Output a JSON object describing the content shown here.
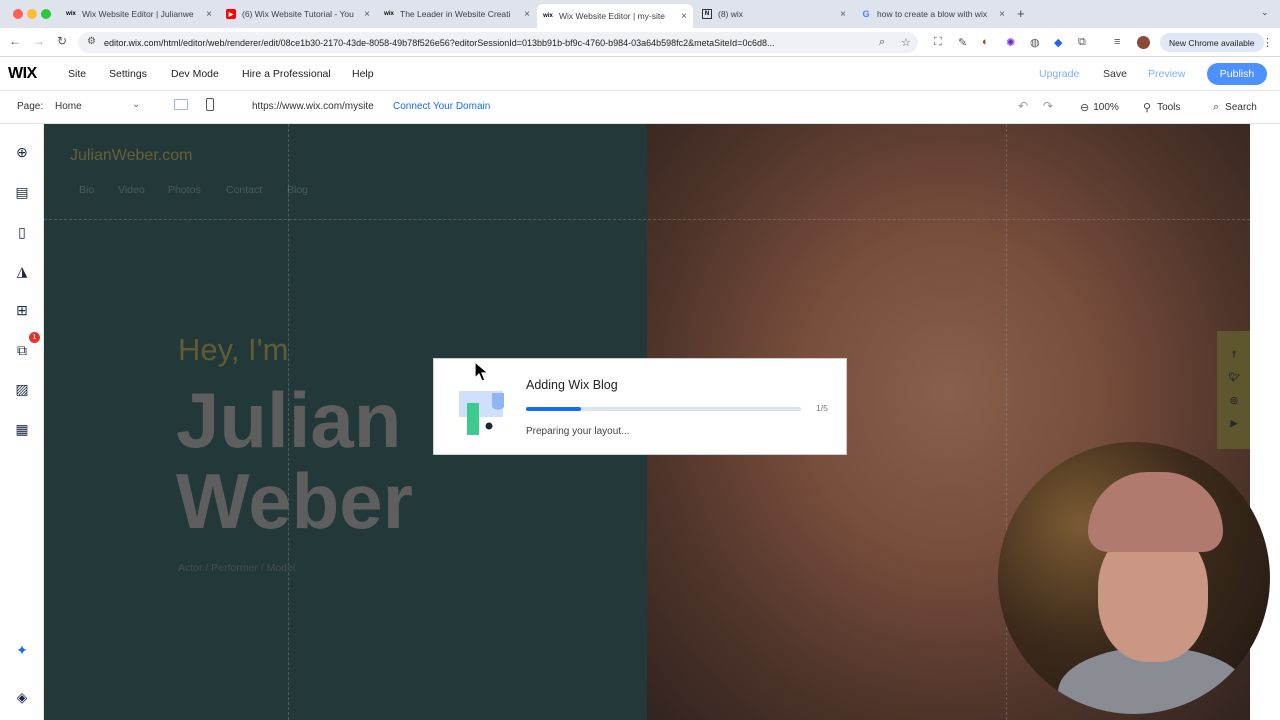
{
  "browser": {
    "tabs": [
      {
        "title": "Wix Website Editor | Julianwe",
        "favicon": "wix-favicon",
        "active": false
      },
      {
        "title": "(6) Wix Website Tutorial - You",
        "favicon": "youtube-favicon",
        "active": false
      },
      {
        "title": "The Leader in Website Creati",
        "favicon": "wix-favicon",
        "active": false
      },
      {
        "title": "Wix Website Editor | my-site",
        "favicon": "wix-favicon",
        "active": true
      },
      {
        "title": "(8) wix",
        "favicon": "notion-favicon",
        "active": false
      },
      {
        "title": "how to create a blow with wix",
        "favicon": "google-favicon",
        "active": false
      }
    ],
    "url": "editor.wix.com/html/editor/web/renderer/edit/08ce1b30-2170-43de-8058-49b78f526e56?editorSessionId=013bb91b-bf9c-4760-b984-03a64b598fc2&metaSiteId=0c6d8...",
    "new_chrome_label": "New Chrome available"
  },
  "wix_top": {
    "logo": "WIX",
    "menu": [
      "Site",
      "Settings",
      "Dev Mode",
      "Hire a Professional",
      "Help"
    ],
    "upgrade": "Upgrade",
    "save": "Save",
    "preview": "Preview",
    "publish": "Publish"
  },
  "wix_sub": {
    "page_label": "Page:",
    "page_value": "Home",
    "site_url": "https://www.wix.com/mysite",
    "connect_domain": "Connect Your Domain",
    "zoom": "100%",
    "tools": "Tools",
    "search": "Search"
  },
  "left_panel": {
    "apps_badge": "1"
  },
  "site": {
    "title": "JulianWeber.com",
    "nav": [
      "Bio",
      "Video",
      "Photos",
      "Contact",
      "Blog"
    ],
    "greeting": "Hey, I'm",
    "first_name": "Julian",
    "last_name": "Weber",
    "role": "Actor / Performer / Model",
    "social_icons": [
      "facebook-icon",
      "twitter-icon",
      "instagram-icon",
      "youtube-icon"
    ]
  },
  "dialog": {
    "title": "Adding Wix Blog",
    "progress": 0.2,
    "step": "1/5",
    "status": "Preparing your layout..."
  },
  "colors": {
    "accent": "#116dff",
    "hero_teal": "#1f4747",
    "hero_gold": "#8f8640"
  }
}
